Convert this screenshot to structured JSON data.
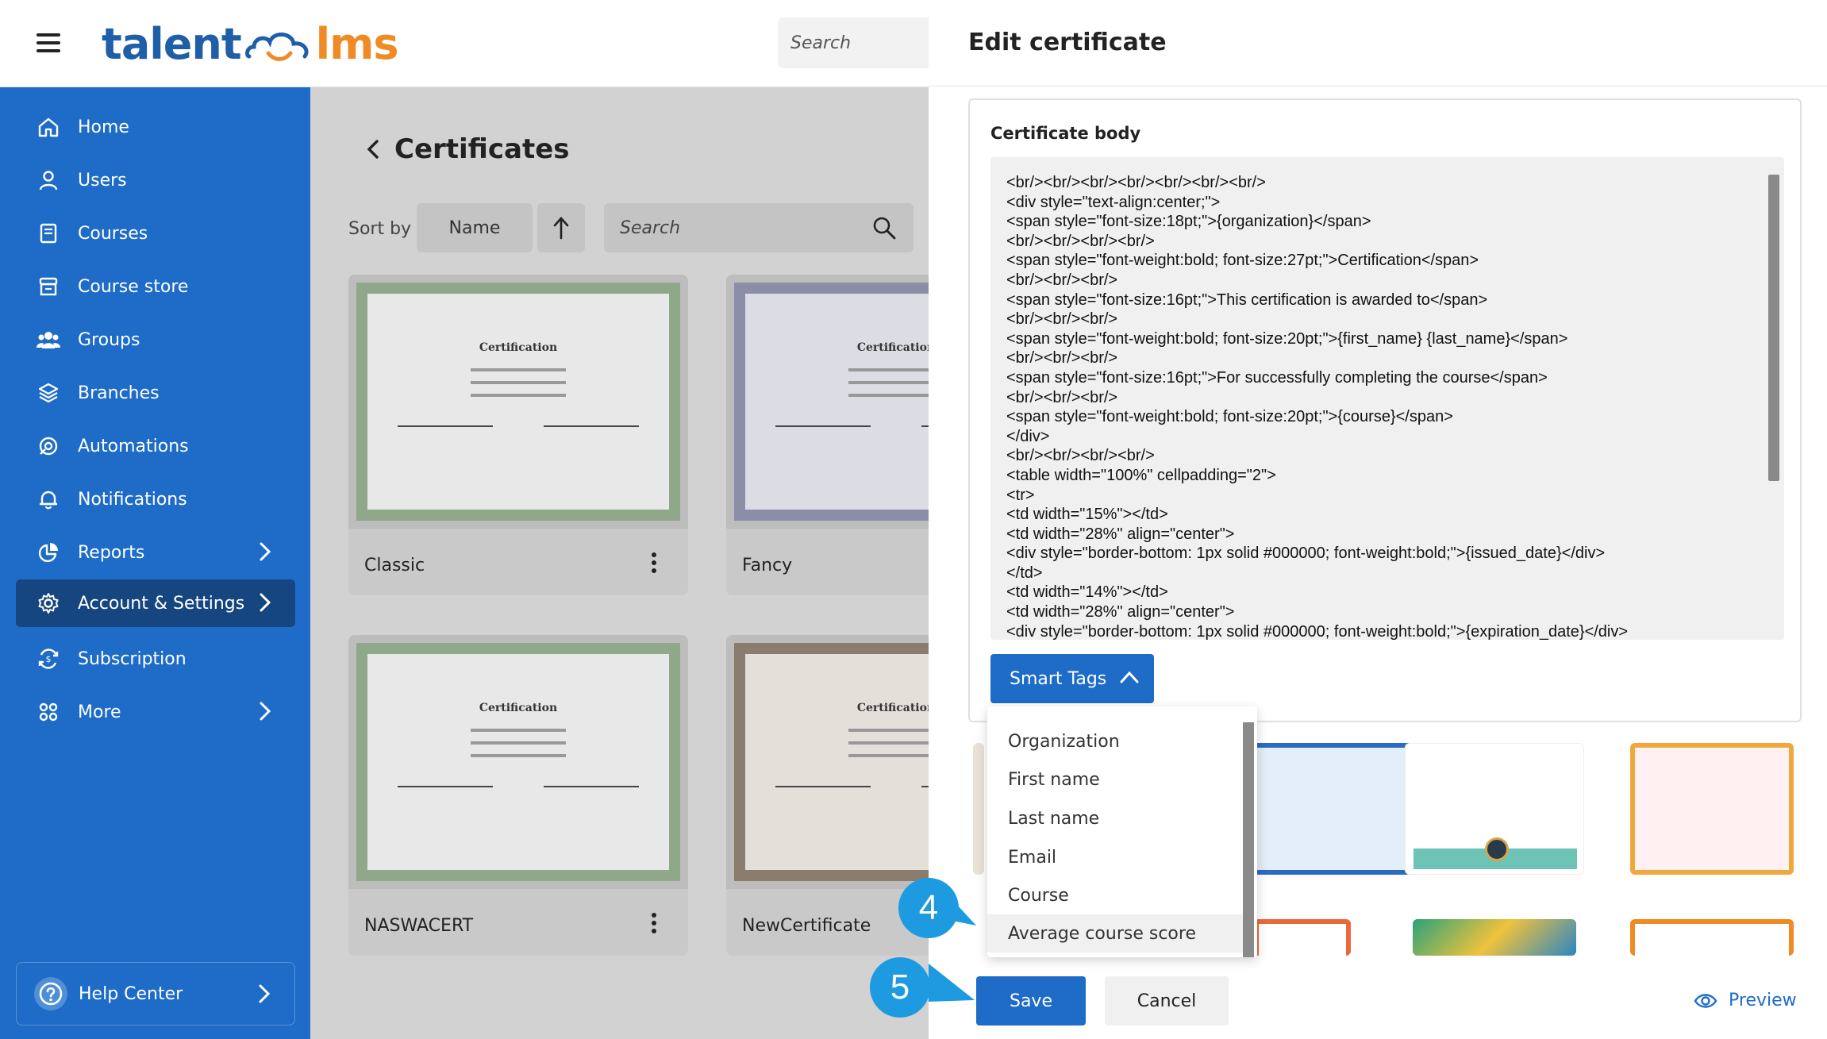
{
  "app": {
    "logo_left": "talent",
    "logo_right": "lms",
    "search_placeholder": "Search"
  },
  "sidebar": {
    "items": [
      {
        "label": "Home",
        "icon": "home-icon"
      },
      {
        "label": "Users",
        "icon": "user-icon"
      },
      {
        "label": "Courses",
        "icon": "book-icon"
      },
      {
        "label": "Course store",
        "icon": "store-icon"
      },
      {
        "label": "Groups",
        "icon": "group-icon"
      },
      {
        "label": "Branches",
        "icon": "layers-icon"
      },
      {
        "label": "Automations",
        "icon": "automation-icon"
      },
      {
        "label": "Notifications",
        "icon": "bell-icon"
      },
      {
        "label": "Reports",
        "icon": "pie-chart-icon"
      },
      {
        "label": "Account & Settings",
        "icon": "gear-icon"
      },
      {
        "label": "Subscription",
        "icon": "subscription-icon"
      },
      {
        "label": "More",
        "icon": "grid-icon"
      }
    ],
    "help_label": "Help Center"
  },
  "main": {
    "title": "Certificates",
    "sort_label": "Sort by",
    "sort_value": "Name",
    "search_placeholder": "Search",
    "cards": [
      {
        "label": "Classic"
      },
      {
        "label": "Fancy"
      },
      {
        "label": "NASWACERT"
      },
      {
        "label": "NewCertificate"
      }
    ],
    "cert_title": "Certification"
  },
  "panel": {
    "title": "Edit certificate",
    "body_label": "Certificate body",
    "code_lines": [
      "<br/><br/><br/><br/><br/><br/><br/>",
      "<div style=\"text-align:center;\">",
      "<span style=\"font-size:18pt;\">{organization}</span>",
      "<br/><br/><br/><br/>",
      "<span style=\"font-weight:bold; font-size:27pt;\">Certification</span>",
      "<br/><br/><br/>",
      "<span style=\"font-size:16pt;\">This certification is awarded to</span>",
      "<br/><br/><br/>",
      "<span style=\"font-weight:bold; font-size:20pt;\">{first_name} {last_name}</span>",
      "<br/><br/><br/>",
      "<span style=\"font-size:16pt;\">For successfully completing the course</span>",
      "<br/><br/><br/>",
      "<span style=\"font-weight:bold; font-size:20pt;\">{course}</span>",
      "</div>",
      "<br/><br/><br/><br/>",
      "<table width=\"100%\" cellpadding=\"2\">",
      "<tr>",
      "<td width=\"15%\"></td>",
      "<td width=\"28%\" align=\"center\">",
      "<div style=\"border-bottom: 1px solid #000000; font-weight:bold;\">{issued_date}</div>",
      "</td>",
      "<td width=\"14%\"></td>",
      "<td width=\"28%\" align=\"center\">",
      "<div style=\"border-bottom: 1px solid #000000; font-weight:bold;\">{expiration_date}</div>"
    ],
    "smart_tags_label": "Smart Tags",
    "smart_tags": [
      "Organization",
      "First name",
      "Last name",
      "Email",
      "Course",
      "Average course score"
    ],
    "save_label": "Save",
    "cancel_label": "Cancel",
    "preview_label": "Preview"
  },
  "callouts": {
    "step4": "4",
    "step5": "5"
  },
  "colors": {
    "brand_blue": "#1e6cc8",
    "brand_orange": "#f08a24",
    "sidebar_active": "#15467f",
    "callout": "#1e9be0"
  }
}
